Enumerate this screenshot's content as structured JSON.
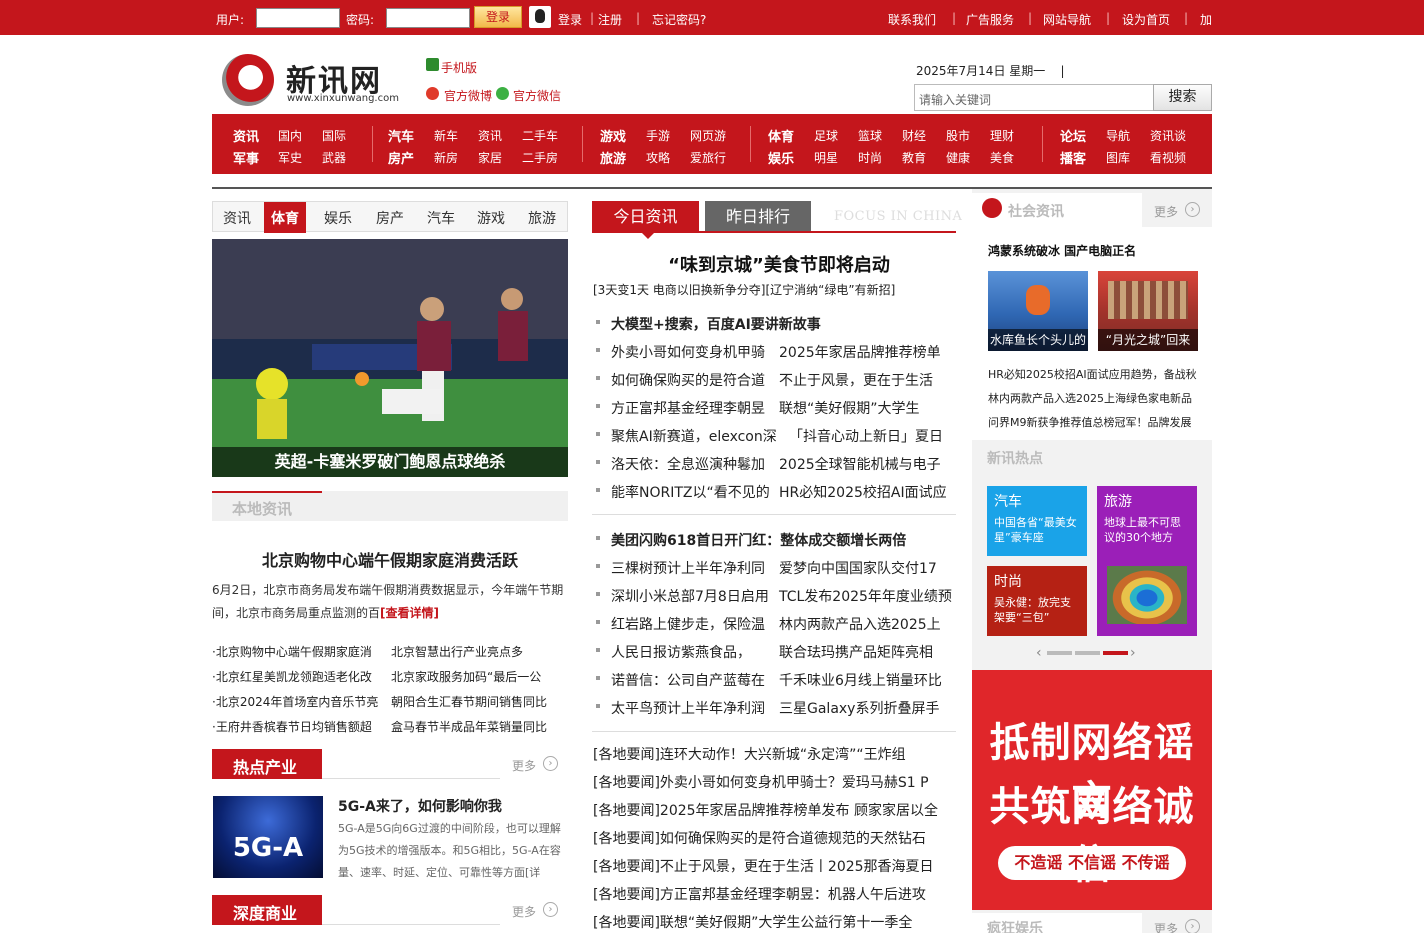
{
  "topbar": {
    "user_label": "用户:",
    "password_label": "密码:",
    "login_button": "登录",
    "qq_login": "登录",
    "register": "注册",
    "forgot": "忘记密码?",
    "right_links": [
      "联系我们",
      "广告服务",
      "网站导航",
      "设为首页",
      "加入收藏"
    ]
  },
  "header": {
    "logo_text": "新讯网",
    "logo_url": "www.xinxunwang.com",
    "mobile": "手机版",
    "weibo": "官方微博",
    "wechat": "官方微信",
    "date": "2025年7月14日  星期一",
    "search_placeholder": "请输入关键词",
    "search_button": "搜索"
  },
  "nav": {
    "groups": [
      {
        "row1": [
          "资讯",
          "国内",
          "国际"
        ],
        "row2": [
          "军事",
          "军史",
          "武器"
        ]
      },
      {
        "row1": [
          "汽车",
          "新车",
          "资讯",
          "二手车"
        ],
        "row2": [
          "房产",
          "新房",
          "家居",
          "二手房"
        ]
      },
      {
        "row1": [
          "游戏",
          "手游",
          "网页游"
        ],
        "row2": [
          "旅游",
          "攻略",
          "爱旅行"
        ]
      },
      {
        "row1": [
          "体育",
          "足球",
          "篮球",
          "财经",
          "股市",
          "理财"
        ],
        "row2": [
          "娱乐",
          "明星",
          "时尚",
          "教育",
          "健康",
          "美食"
        ]
      },
      {
        "row1": [
          "论坛",
          "导航",
          "资讯谈"
        ],
        "row2": [
          "播客",
          "图库",
          "看视频"
        ]
      }
    ]
  },
  "left": {
    "tabs": [
      "资讯",
      "体育",
      "娱乐",
      "房产",
      "汽车",
      "游戏",
      "旅游"
    ],
    "active_tab": "体育",
    "photo_caption": "英超-卡塞米罗破门鲍恩点球绝杀",
    "local_title": "本地资讯",
    "local_headline": "北京购物中心端午假期家庭消费活跃",
    "local_body": "6月2日，北京市商务局发布端午假期消费数据显示，今年端午节期间，北京市商务局重点监测的百",
    "local_more": "[查看详情]",
    "local_list": [
      [
        "·北京购物中心端午假期家庭消",
        "北京智慧出行产业亮点多"
      ],
      [
        "·北京红星美凯龙领跑适老化改",
        "北京家政服务加码“最后一公"
      ],
      [
        "·北京2024年首场室内音乐节亮",
        "朝阳合生汇春节期间销售同比"
      ],
      [
        "·王府井香槟春节日均销售额超",
        "盒马春节半成品年菜销量同比"
      ]
    ],
    "hot_industry": "热点产业",
    "more": "更多",
    "g5_thumb": "5G-A",
    "g5_title": "5G-A来了，如何影响你我",
    "g5_body": "5G-A是5G向6G过渡的中间阶段，也可以理解为5G技术的增强版本。和5G相比，5G-A在容量、速率、时延、定位、可靠性等方面[详",
    "deep_business": "深度商业"
  },
  "middle": {
    "tab_today": "今日资讯",
    "tab_yesterday": "昨日排行",
    "focus": "FOCUS IN CHINA",
    "headline": "“味到京城”美食节即将启动",
    "sub": "[3天变1天 电商以旧换新争分夺][辽宁消纳“绿电”有新招]",
    "block1_lead": "大模型+搜索，百度AI要讲新故事",
    "block1": [
      [
        "外卖小哥如何变身机甲骑",
        "2025年家居品牌推荐榜单"
      ],
      [
        "如何确保购买的是符合道",
        "不止于风景，更在于生活"
      ],
      [
        "方正富邦基金经理李朝昱",
        "联想“美好假期”大学生"
      ],
      [
        "聚焦AI新赛道，elexcon深",
        "「抖音心动上新日」夏日"
      ],
      [
        "洛天依：全息巡演种鬈加",
        "2025全球智能机械与电子"
      ],
      [
        "能率NORITZ以“看不见的",
        "HR必知2025校招AI面试应"
      ]
    ],
    "block2_lead": "美团闪购618首日开门红：整体成交额增长两倍",
    "block2": [
      [
        "三棵树预计上半年净利同",
        "爱梦向中国国家队交付17"
      ],
      [
        "深圳小米总部7月8日启用",
        "TCL发布2025年年度业绩预"
      ],
      [
        "红岩路上健步走，保险温",
        "林内两款产品入选2025上"
      ],
      [
        "人民日报访紫燕食品，",
        "联合珐玛携产品矩阵亮相"
      ],
      [
        "诺普信：公司自产蓝莓在",
        "千禾味业6月线上销量环比"
      ],
      [
        "太平鸟预计上半年净利润",
        "三星Galaxy系列折叠屏手"
      ]
    ],
    "local_news": [
      "[各地要闻]连环大动作！大兴新城“永定湾”“王炸组",
      "[各地要闻]外卖小哥如何变身机甲骑士？爱玛马赫S1 P",
      "[各地要闻]2025年家居品牌推荐榜单发布 顾家家居以全",
      "[各地要闻]如何确保购买的是符合道德规范的天然钻石",
      "[各地要闻]不止于风景，更在于生活丨2025那香海夏日",
      "[各地要闻]方正富邦基金经理李朝昱：机器人午后进攻",
      "[各地要闻]联想“美好假期”大学生公益行第十一季全"
    ]
  },
  "right": {
    "social_title": "社会资讯",
    "more": "更多",
    "bold_line": "鸿蒙系统破冰 国产电脑正名",
    "pic1_caption": "水库鱼长个头儿的",
    "pic2_caption": "“月光之城”回来",
    "lines": [
      "HR必知2025校招AI面试应用趋势，备战秋",
      "林内两款产品入选2025上海绿色家电新品",
      "问界M9新获争推荐值总榜冠军！品牌发展"
    ],
    "hot_title": "新讯热点",
    "tiles": [
      {
        "title": "汽车",
        "sub": "中国各省“最美女星”豪车座"
      },
      {
        "title": "旅游",
        "sub": "地球上最不可思议的30个地方"
      },
      {
        "title": "时尚",
        "sub": "吴永健：放完支架要“三包”"
      }
    ],
    "ad_line1": "抵制网络谣言",
    "ad_line2": "共筑网络诚信",
    "ad_pill": "不造谣 不信谣 不传谣",
    "bottom_title": "疯狂娱乐"
  },
  "colors": {
    "brand_red": "#c4161c",
    "tile_blue": "#1aa3e8",
    "tile_purple": "#9b1fb8",
    "tile_darkred": "#b52114"
  }
}
